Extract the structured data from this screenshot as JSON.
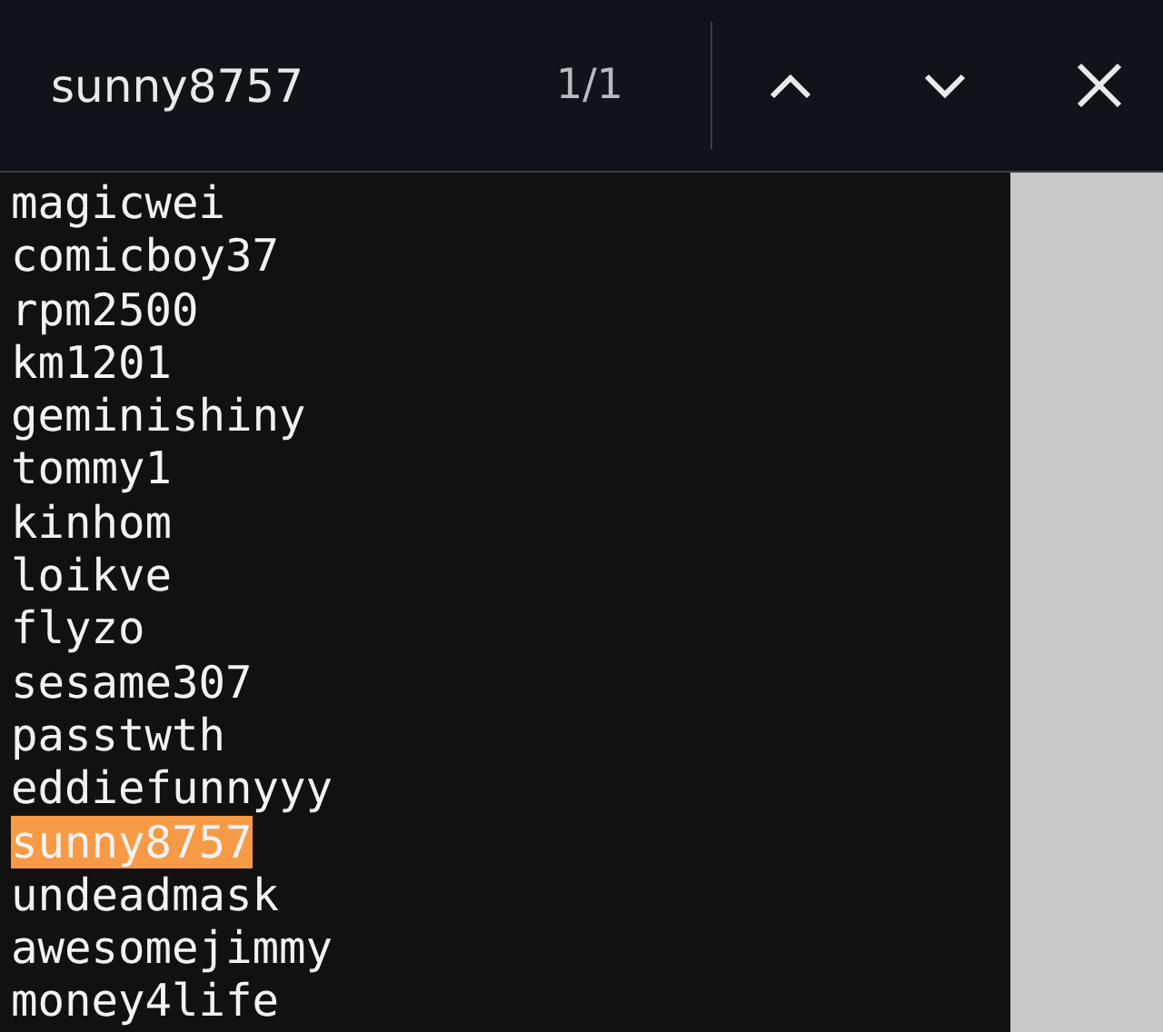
{
  "find_bar": {
    "query": "sunny8757",
    "match_count": "1/1"
  },
  "lines": [
    {
      "text": "magicwei",
      "highlighted": false
    },
    {
      "text": "comicboy37",
      "highlighted": false
    },
    {
      "text": "rpm2500",
      "highlighted": false
    },
    {
      "text": "km1201",
      "highlighted": false
    },
    {
      "text": "geminishiny",
      "highlighted": false
    },
    {
      "text": "tommy1",
      "highlighted": false
    },
    {
      "text": "kinhom",
      "highlighted": false
    },
    {
      "text": "loikve",
      "highlighted": false
    },
    {
      "text": "flyzo",
      "highlighted": false
    },
    {
      "text": "sesame307",
      "highlighted": false
    },
    {
      "text": "passtwth",
      "highlighted": false
    },
    {
      "text": "eddiefunnyyy",
      "highlighted": false
    },
    {
      "text": "sunny8757",
      "highlighted": true
    },
    {
      "text": "undeadmask",
      "highlighted": false
    },
    {
      "text": "awesomejimmy",
      "highlighted": false
    },
    {
      "text": "money4life",
      "highlighted": false
    }
  ]
}
